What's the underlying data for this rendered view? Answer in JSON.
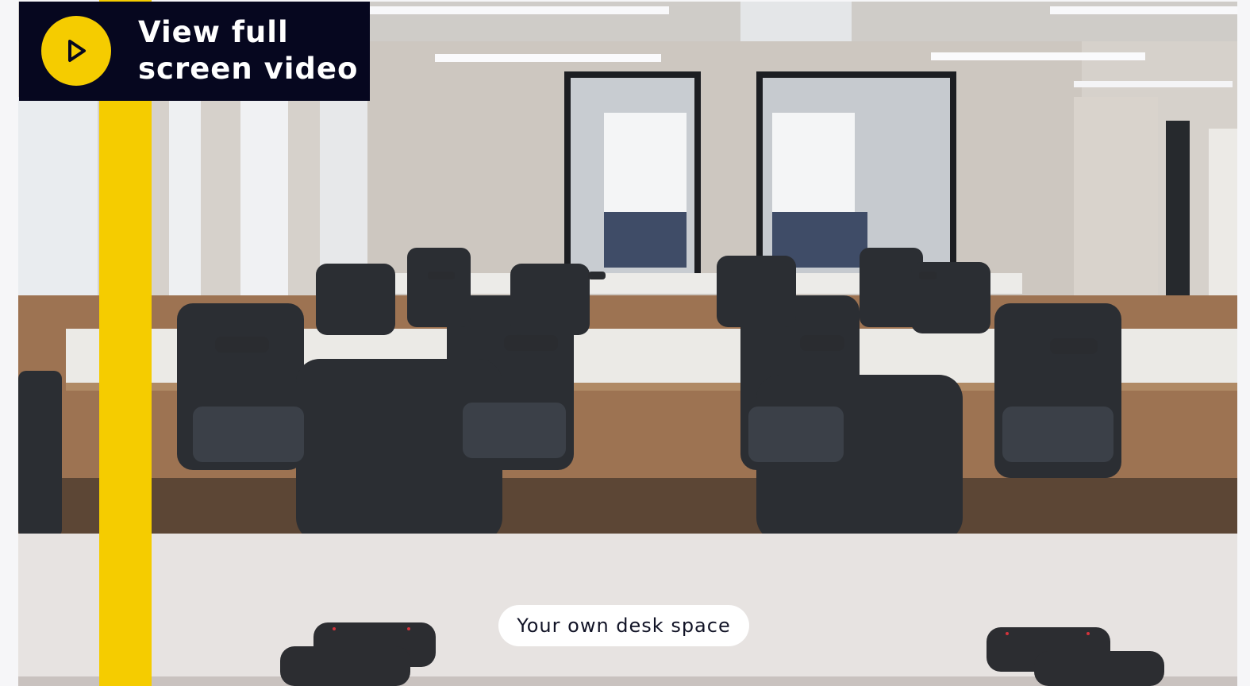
{
  "cta": {
    "label": "View full screen video",
    "icon": "play-icon"
  },
  "caption": {
    "text": "Your own desk space"
  },
  "colors": {
    "accent_yellow": "#f5cc00",
    "cta_background": "#06071f",
    "caption_background": "#ffffff",
    "caption_text": "#111326"
  }
}
